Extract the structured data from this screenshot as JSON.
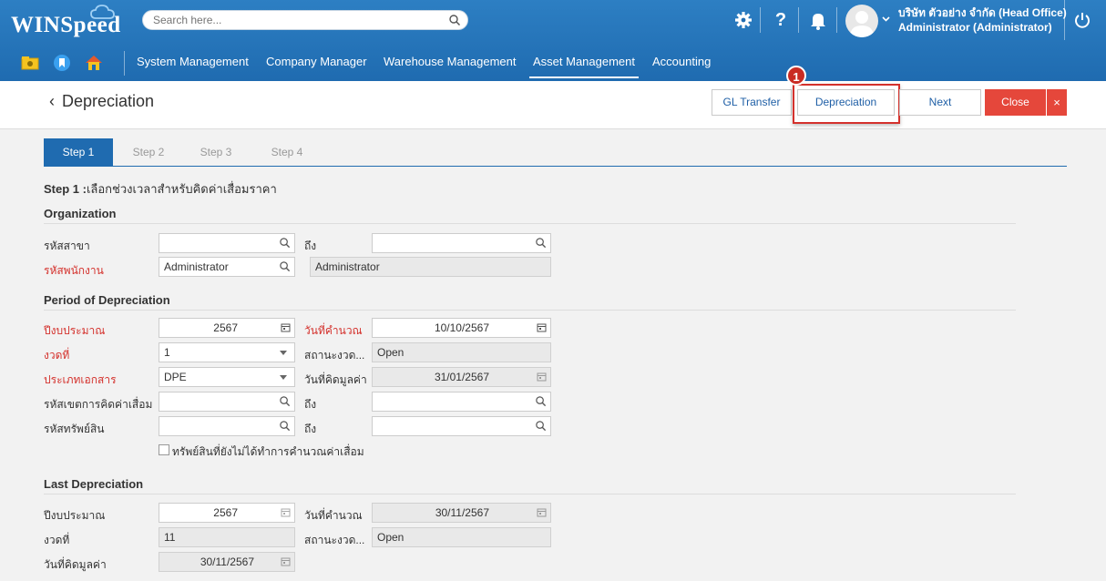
{
  "app": {
    "logo_text": "WINSpeed",
    "search_placeholder": "Search here...",
    "company": "บริษัท ตัวอย่าง จำกัด (Head Office)",
    "user": "Administrator (Administrator)",
    "brand_color": "#1f6bb0"
  },
  "menu": {
    "items": [
      "System Management",
      "Company Manager",
      "Warehouse Management",
      "Asset Management",
      "Accounting"
    ],
    "active": "Asset Management"
  },
  "page": {
    "title": "Depreciation",
    "buttons": {
      "gl_transfer": "GL Transfer",
      "depreciation": "Depreciation",
      "next": "Next",
      "close": "Close",
      "close_x": "×"
    },
    "callout_number": "1"
  },
  "steps": [
    "Step 1",
    "Step 2",
    "Step 3",
    "Step 4"
  ],
  "step_title": {
    "bold": "Step 1 :",
    "text": "เลือกช่วงเวลาสำหรับคิดค่าเสื่อมราคา"
  },
  "organization": {
    "heading": "Organization",
    "branch_label": "รหัสสาขา",
    "branch_from": "",
    "to_label": "ถึง",
    "branch_to": "",
    "employee_label": "รหัสพนักงาน",
    "employee_code": "Administrator",
    "employee_name": "Administrator"
  },
  "period": {
    "heading": "Period of Depreciation",
    "fiscal_year_label": "ปีงบประมาณ",
    "fiscal_year": "2567",
    "calc_date_label": "วันที่คำนวณ",
    "calc_date": "10/10/2567",
    "period_label": "งวดที่",
    "period": "1",
    "period_status_label": "สถานะงวด...",
    "period_status": "Open",
    "doc_type_label": "ประเภทเอกสาร",
    "doc_type": "DPE",
    "dep_date_label": "วันที่คิดมูลค่า",
    "dep_date": "31/01/2567",
    "zone_label": "รหัสเขตการคิดค่าเสื่อม",
    "zone_from": "",
    "to_label": "ถึง",
    "zone_to": "",
    "asset_label": "รหัสทรัพย์สิน",
    "asset_from": "",
    "asset_to": "",
    "checkbox_label": "ทรัพย์สินที่ยังไม่ได้ทำการคำนวณค่าเสื่อม",
    "checkbox_checked": false
  },
  "last": {
    "heading": "Last Depreciation",
    "fiscal_year_label": "ปีงบประมาณ",
    "fiscal_year": "2567",
    "calc_date_label": "วันที่คำนวณ",
    "calc_date": "30/11/2567",
    "period_label": "งวดที่",
    "period": "11",
    "period_status_label": "สถานะงวด...",
    "period_status": "Open",
    "dep_date_label": "วันที่คิดมูลค่า",
    "dep_date": "30/11/2567"
  }
}
